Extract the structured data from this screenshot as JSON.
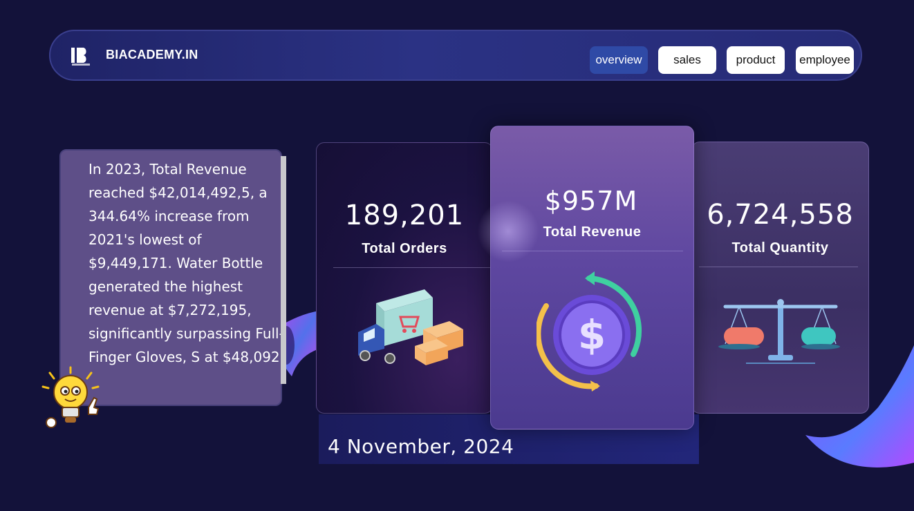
{
  "header": {
    "brand": "BIACADEMY.IN",
    "logo_icon": "bi-academy-logo",
    "nav": [
      {
        "label": "overview",
        "active": true
      },
      {
        "label": "sales",
        "active": false
      },
      {
        "label": "product",
        "active": false
      },
      {
        "label": "employee",
        "active": false
      }
    ]
  },
  "insight": {
    "text": "In 2023, Total Revenue reached $42,014,492,5, a 344.64% increase from 2021's lowest of $9,449,171. Water Bottle generated the highest revenue at $7,272,195, significantly surpassing Full-Finger Gloves, S at $48,092"
  },
  "kpis": [
    {
      "value": "189,201",
      "label": "Total Orders",
      "icon": "delivery-truck-icon"
    },
    {
      "value": "$957M",
      "label": "Total Revenue",
      "icon": "dollar-coin-icon"
    },
    {
      "value": "6,724,558",
      "label": "Total Quantity",
      "icon": "balance-scale-icon"
    }
  ],
  "date": "4 November, 2024",
  "colors": {
    "background": "#13123a",
    "navbar": "#2b3284",
    "active_tab": "#2f4aa6",
    "insight_panel": "#5e4f88",
    "card_highlight": "#7a5ba8"
  }
}
